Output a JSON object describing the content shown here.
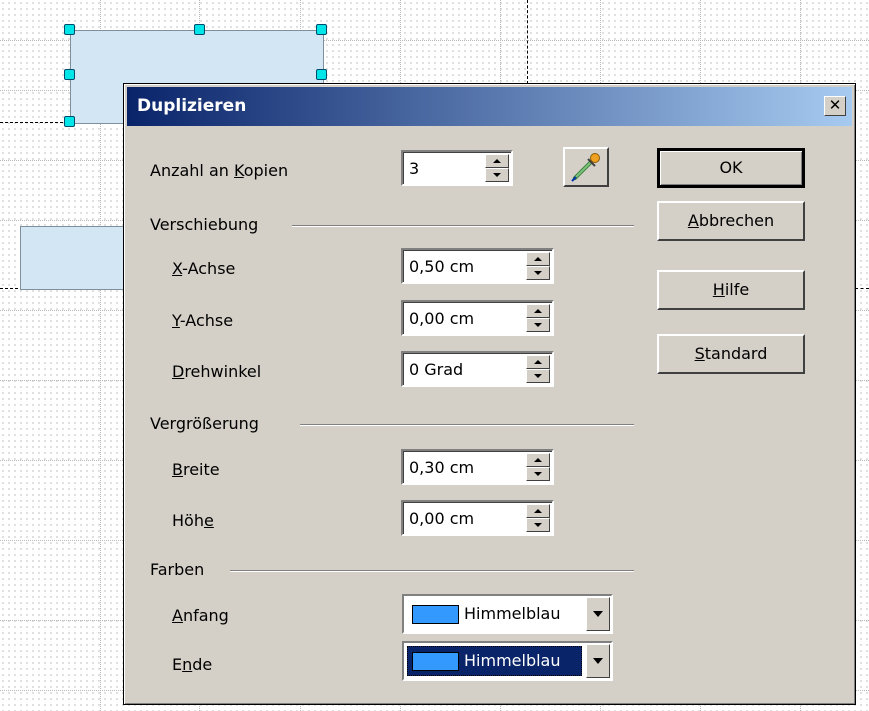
{
  "dialog": {
    "title": "Duplizieren",
    "close_glyph": "✕",
    "copies": {
      "label_pre": "Anzahl an ",
      "label_mn": "K",
      "label_post": "opien",
      "value": "3"
    },
    "pipette_icon": "pipette-icon",
    "sections": {
      "verschiebung": "Verschiebung",
      "vergroesserung": "Vergrößerung",
      "farben": "Farben"
    },
    "fields": {
      "x": {
        "mn": "X",
        "rest": "-Achse",
        "value": "0,50 cm"
      },
      "y": {
        "mn": "Y",
        "rest": "-Achse",
        "value": "0,00 cm"
      },
      "rot": {
        "mn": "D",
        "rest": "rehwinkel",
        "value": "0 Grad"
      },
      "breite": {
        "mn": "B",
        "rest": "reite",
        "value": "0,30 cm"
      },
      "hoehe": {
        "pre": "Höh",
        "mn": "e",
        "value": "0,00 cm"
      }
    },
    "colors": {
      "anfang": {
        "mn": "A",
        "rest": "nfang",
        "value": "Himmelblau",
        "swatch": "#3399ff"
      },
      "ende": {
        "pre": "E",
        "mn": "n",
        "rest": "de",
        "value": "Himmelblau",
        "swatch": "#3399ff"
      }
    },
    "buttons": {
      "ok": "OK",
      "cancel": {
        "mn": "A",
        "rest": "bbrechen"
      },
      "help": {
        "mn": "H",
        "rest": "ilfe"
      },
      "standard": {
        "mn": "S",
        "rest": "tandard"
      }
    }
  },
  "colors": {
    "title_start": "#0a246a",
    "title_end": "#a6caf0",
    "dialog_bg": "#d4d0c8",
    "shape_fill": "#d3e6f3",
    "handle": "#00e5e8"
  }
}
